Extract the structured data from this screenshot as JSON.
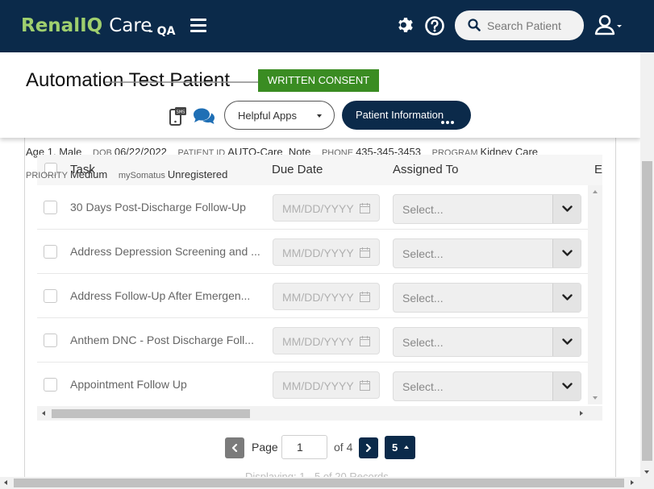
{
  "header": {
    "logo_part1": "RenalIQ",
    "logo_part2": "Care",
    "environment": "- QA",
    "search_placeholder": "Search Patient"
  },
  "patient": {
    "name": "Automation Test Patient",
    "consent_badge": "WRITTEN CONSENT",
    "helpful_apps_label": "Helpful Apps",
    "patient_info_label": "Patient Information",
    "details": {
      "age_sex": "Age 1, Male",
      "dob_label": "DOB",
      "dob": "06/22/2022",
      "patient_id_label": "PATIENT ID",
      "patient_id": "AUTO-Care_Note",
      "phone_label": "PHONE",
      "phone": "435-345-3453",
      "program_label": "PROGRAM",
      "program": "Kidney Care",
      "priority_label": "PRIORITY",
      "priority": "Medium",
      "mysomatus_label": "mySomatus",
      "mysomatus": "Unregistered"
    }
  },
  "grid": {
    "columns": [
      "Task",
      "Due Date",
      "Assigned To",
      "E"
    ],
    "rows": [
      {
        "task": "30 Days Post-Discharge Follow-Up",
        "due_placeholder": "MM/DD/YYYY",
        "assigned": "Select..."
      },
      {
        "task": "Address Depression Screening and ...",
        "due_placeholder": "MM/DD/YYYY",
        "assigned": "Select..."
      },
      {
        "task": "Address Follow-Up After Emergen...",
        "due_placeholder": "MM/DD/YYYY",
        "assigned": "Select..."
      },
      {
        "task": "Anthem DNC - Post Discharge Foll...",
        "due_placeholder": "MM/DD/YYYY",
        "assigned": "Select..."
      },
      {
        "task": "Appointment Follow Up",
        "due_placeholder": "MM/DD/YYYY",
        "assigned": "Select..."
      }
    ]
  },
  "pagination": {
    "page_label": "Page",
    "current_page": "1",
    "of_label": "of 4",
    "page_size": "5",
    "displaying": "Displaying: 1 - 5 of 20 Records"
  },
  "colors": {
    "navy": "#0b2a4a",
    "logo_green": "#9fcf6e",
    "consent_green": "#3a8c22"
  }
}
